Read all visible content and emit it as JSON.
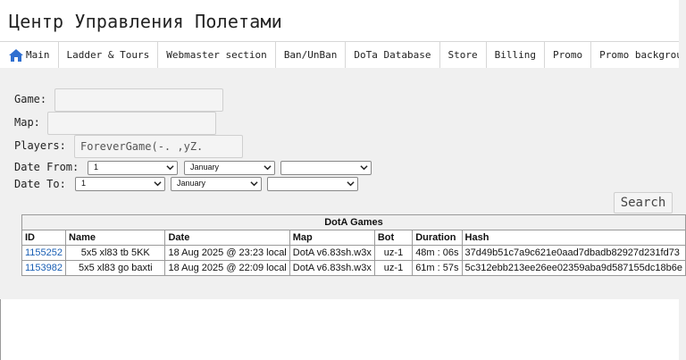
{
  "header": {
    "title": "Центр Управления Полетами"
  },
  "nav": {
    "items": [
      {
        "label": "Main",
        "icon": "home-icon"
      },
      {
        "label": "Ladder & Tours"
      },
      {
        "label": "Webmaster section"
      },
      {
        "label": "Ban/UnBan"
      },
      {
        "label": "DoTa Database"
      },
      {
        "label": "Store"
      },
      {
        "label": "Billing"
      },
      {
        "label": "Promo"
      },
      {
        "label": "Promo background"
      }
    ]
  },
  "form": {
    "game_label": "Game:",
    "game_value": "",
    "map_label": "Map:",
    "map_value": "",
    "players_label": "Players:",
    "players_value": "ForeverGame(-. ,yZ.",
    "date_from_label": "Date From:",
    "date_from_day": "1",
    "date_from_month": "January",
    "date_from_year": "",
    "date_to_label": "Date To:",
    "date_to_day": "1",
    "date_to_month": "January",
    "date_to_year": "",
    "search_label": "Search"
  },
  "table": {
    "caption": "DotA Games",
    "columns": [
      "ID",
      "Name",
      "Date",
      "Map",
      "Bot",
      "Duration",
      "Hash"
    ],
    "rows": [
      {
        "id": "1155252",
        "name": "5x5 xl83 tb 5KK",
        "date": "18 Aug 2025 @ 23:23 local",
        "map": "DotA v6.83sh.w3x",
        "bot": "uz-1",
        "duration": "48m : 06s",
        "hash": "37d49b51c7a9c621e0aad7dbadb82927d231fd73"
      },
      {
        "id": "1153982",
        "name": "5x5 xl83 go baxti",
        "date": "18 Aug 2025 @ 22:09 local",
        "map": "DotA v6.83sh.w3x",
        "bot": "uz-1",
        "duration": "61m : 57s",
        "hash": "5c312ebb213ee26ee02359aba9d587155dc18b6e"
      }
    ]
  },
  "colors": {
    "link": "#1a5fb4",
    "home_icon": "#2f6fd0",
    "panel_bg": "#f0f0f0"
  }
}
